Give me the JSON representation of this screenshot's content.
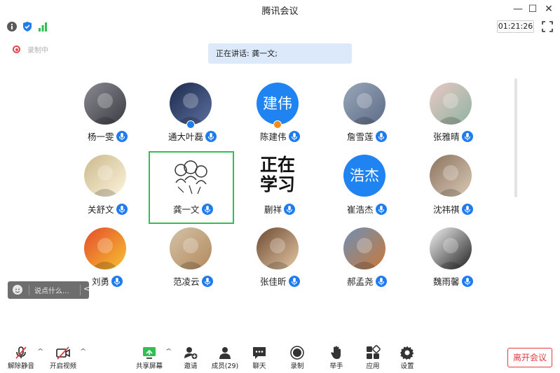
{
  "window": {
    "title": "腾讯会议",
    "minimize": "—",
    "maximize": "☐",
    "close": "✕"
  },
  "topbar": {
    "timer": "01:21:26",
    "icons": [
      "info-icon",
      "shield-icon",
      "signal-icon",
      "fullscreen-icon"
    ],
    "colors": {
      "info": "#5a5a5a",
      "shield": "#1f7cf0",
      "signal": "#2fbf53"
    }
  },
  "recording": {
    "label": "录制中"
  },
  "speaking": {
    "text": "正在讲话: 龚一文;"
  },
  "participants": [
    {
      "name": "杨一雯",
      "avatar": "photo"
    },
    {
      "name": "通大叶磊",
      "avatar": "photo",
      "badge": "blue"
    },
    {
      "name": "陈建伟",
      "avatar": "text",
      "avatar_text": "建伟",
      "badge": "orange"
    },
    {
      "name": "詹雪莲",
      "avatar": "photo"
    },
    {
      "name": "张雅晴",
      "avatar": "photo"
    },
    {
      "name": "关舒文",
      "avatar": "photo"
    },
    {
      "name": "龚一文",
      "avatar": "photo",
      "active": true
    },
    {
      "name": "蒯祥",
      "avatar": "bigtext",
      "avatar_lines": [
        "正在",
        "学习"
      ]
    },
    {
      "name": "崔浩杰",
      "avatar": "text",
      "avatar_text": "浩杰"
    },
    {
      "name": "沈祎祺",
      "avatar": "photo"
    },
    {
      "name": "刘勇",
      "avatar": "photo"
    },
    {
      "name": "范凌云",
      "avatar": "photo"
    },
    {
      "name": "张佳昕",
      "avatar": "photo"
    },
    {
      "name": "郝孟尧",
      "avatar": "photo"
    },
    {
      "name": "魏雨馨",
      "avatar": "photo"
    }
  ],
  "chat": {
    "placeholder": "说点什么...",
    "collapse": "<"
  },
  "toolbar": {
    "unmute": "解除静音",
    "video": "开启视频",
    "share": "共享屏幕",
    "invite": "邀请",
    "members": "成员(29)",
    "chat": "聊天",
    "record": "录制",
    "raise_hand": "举手",
    "apps": "应用",
    "settings": "设置",
    "leave": "离开会议",
    "caret": "^"
  },
  "colors": {
    "accent": "#1f7cf0",
    "active_border": "#2fbf53",
    "danger": "#e23c3c"
  }
}
